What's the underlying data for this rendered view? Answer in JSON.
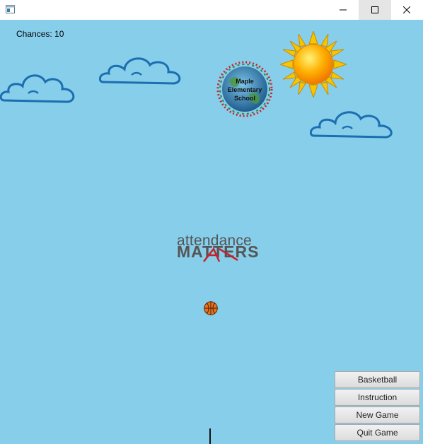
{
  "window": {
    "icon": "app-window-icon",
    "controls": [
      "minimize-icon",
      "maximize-icon",
      "close-icon"
    ]
  },
  "hud": {
    "chances_text": "Chances: 10"
  },
  "logos": {
    "school": "Maple Elementary School",
    "banner_top": "attendance",
    "banner_bottom": "MATTERS"
  },
  "menu": {
    "basketball": "Basketball",
    "instruction": "Instruction",
    "new_game": "New Game",
    "quit_game": "Quit Game"
  },
  "colors": {
    "sky": "#87CEEB",
    "cloud_outline": "#1B6EB0",
    "sun": "#FFA500",
    "ball": "#E8721C"
  }
}
